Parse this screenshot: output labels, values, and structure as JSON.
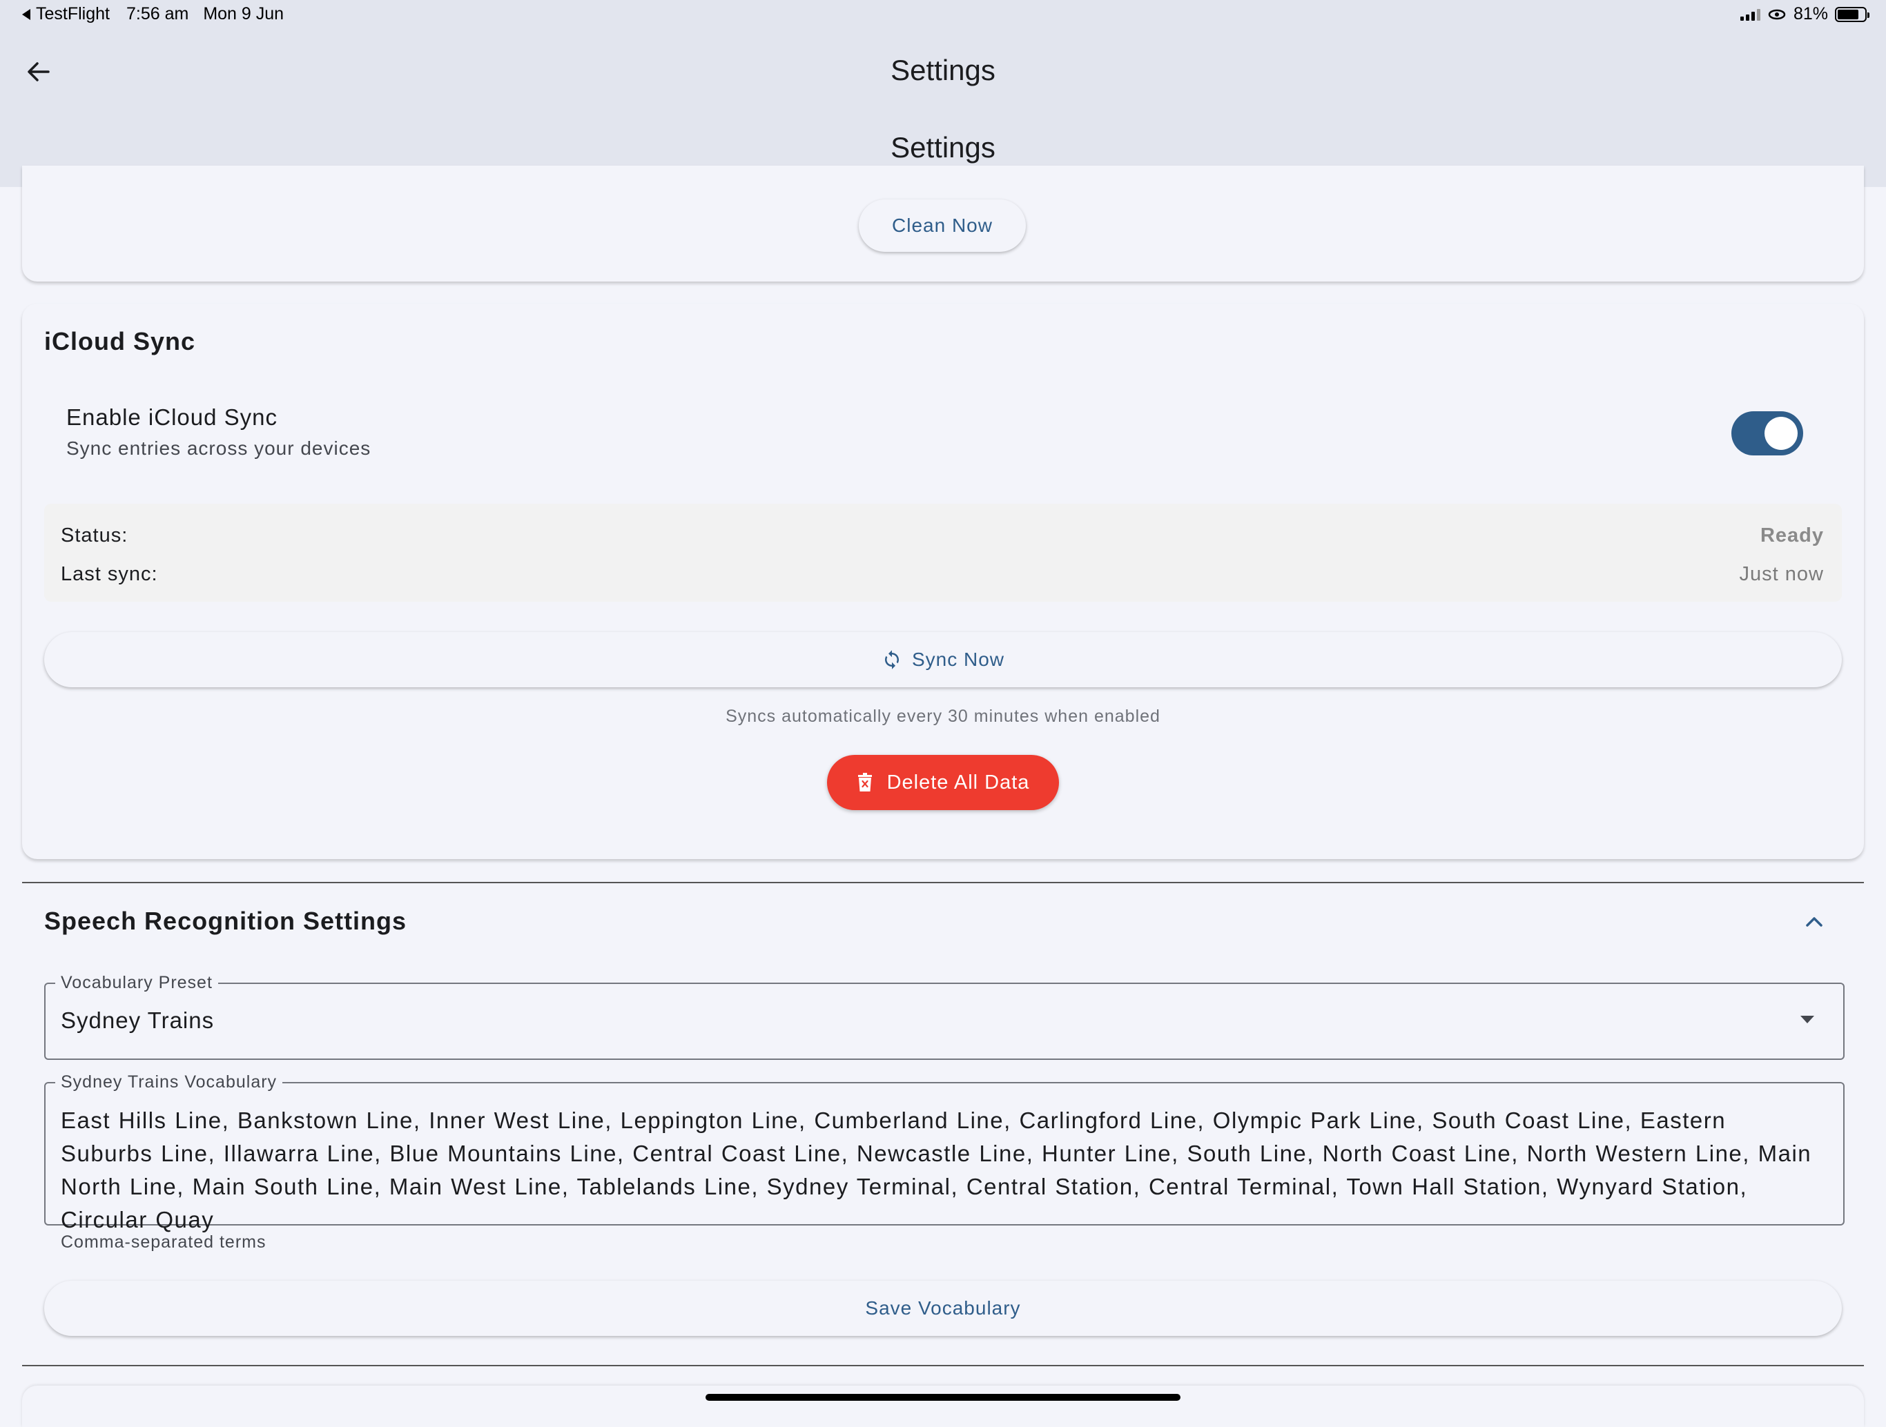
{
  "status_bar": {
    "back_app": "TestFlight",
    "time": "7:56 am",
    "date": "Mon 9 Jun",
    "battery": "81%"
  },
  "app_bar": {
    "title": "Settings",
    "subtitle": "Settings"
  },
  "cleanup": {
    "clean_button": "Clean Now"
  },
  "icloud": {
    "title": "iCloud Sync",
    "enable_label": "Enable iCloud Sync",
    "enable_sub": "Sync entries across your devices",
    "enabled": true,
    "status_label": "Status:",
    "status_value": "Ready",
    "last_sync_label": "Last sync:",
    "last_sync_value": "Just now",
    "sync_button": "Sync Now",
    "auto_note": "Syncs automatically every 30 minutes when enabled",
    "delete_button": "Delete All Data"
  },
  "speech": {
    "title": "Speech Recognition Settings",
    "preset_label": "Vocabulary Preset",
    "preset_value": "Sydney Trains",
    "vocab_label": "Sydney Trains Vocabulary",
    "vocab_text": "East Hills Line, Bankstown Line, Inner West Line, Leppington Line, Cumberland Line, Carlingford Line, Olympic Park Line, South Coast Line, Eastern Suburbs Line, Illawarra Line, Blue Mountains Line, Central Coast Line, Newcastle Line, Hunter Line, South Line, North Coast Line, North Western Line, Main North Line, Main South Line, Main West Line, Tablelands Line, Sydney Terminal, Central Station, Central Terminal, Town Hall Station, Wynyard Station, Circular Quay",
    "helper": "Comma-separated terms",
    "save_button": "Save Vocabulary"
  },
  "colors": {
    "accent": "#2f5d8a",
    "danger": "#ee3b2f",
    "app_bar_bg": "#e2e5ee",
    "page_bg": "#f3f4fa"
  }
}
